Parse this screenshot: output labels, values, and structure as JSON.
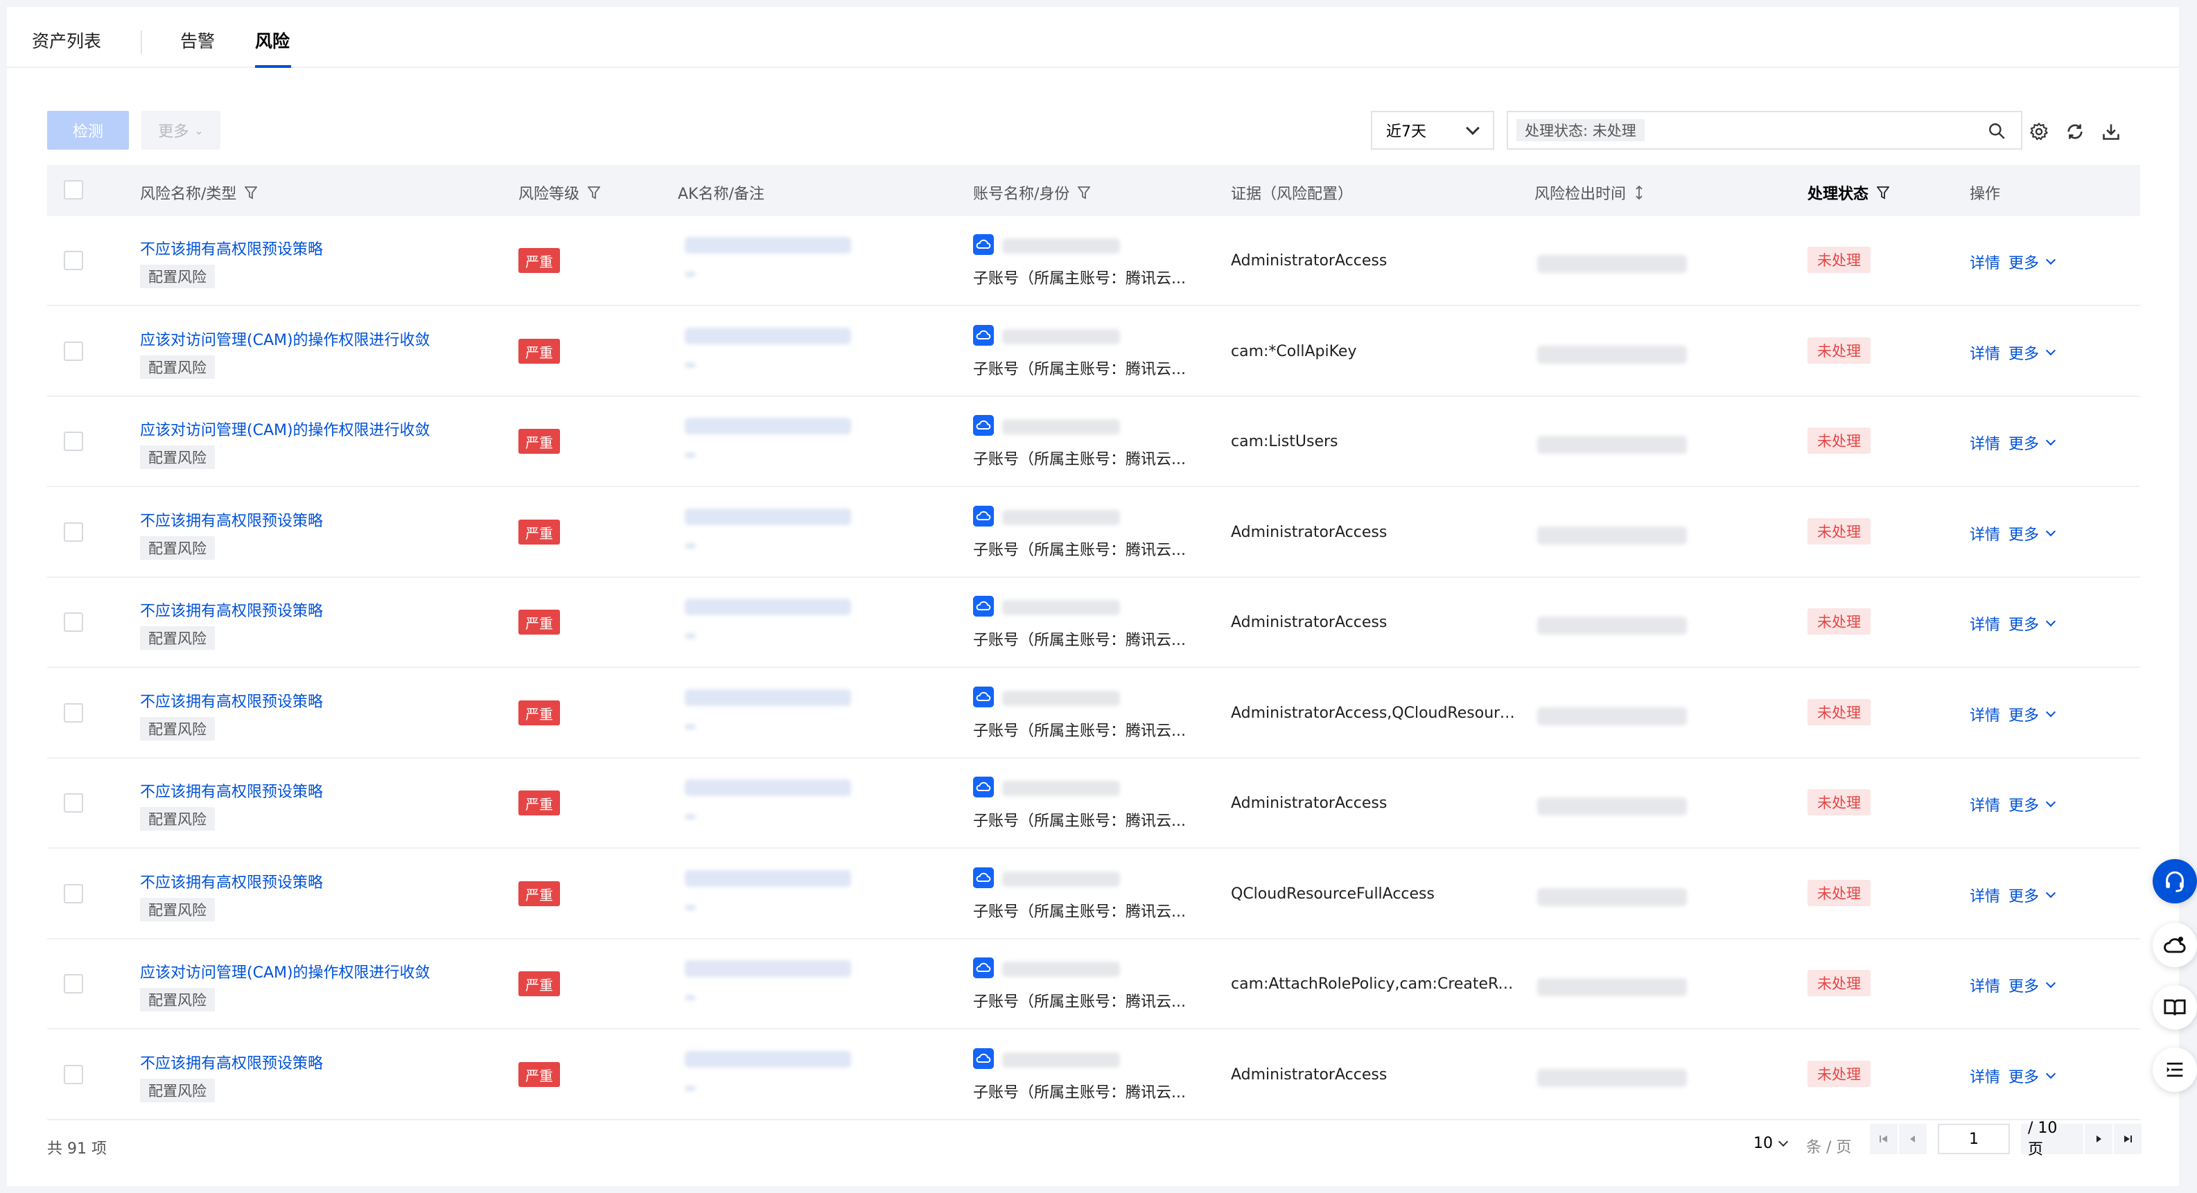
{
  "tabs": [
    {
      "label": "资产列表"
    },
    {
      "label": "告警"
    },
    {
      "label": "风险",
      "active": true
    }
  ],
  "toolbar": {
    "detect_label": "检测",
    "more_label": "更多",
    "time_range": "近7天",
    "filter_tag": "处理状态: 未处理"
  },
  "table": {
    "headers": {
      "risk_name": "风险名称/类型",
      "risk_level": "风险等级",
      "ak_name": "AK名称/备注",
      "account": "账号名称/身份",
      "evidence": "证据（风险配置）",
      "detect_time": "风险检出时间",
      "status": "处理状态",
      "ops": "操作"
    },
    "rows": [
      {
        "name": "不应该拥有高权限预设策略",
        "type": "配置风险",
        "level": "严重",
        "account": "子账号（所属主账号：腾讯云...",
        "evidence": "AdministratorAccess",
        "status": "未处理",
        "detail": "详情",
        "more": "更多"
      },
      {
        "name": "应该对访问管理(CAM)的操作权限进行收敛",
        "type": "配置风险",
        "level": "严重",
        "account": "子账号（所属主账号：腾讯云...",
        "evidence": "cam:*CollApiKey",
        "status": "未处理",
        "detail": "详情",
        "more": "更多"
      },
      {
        "name": "应该对访问管理(CAM)的操作权限进行收敛",
        "type": "配置风险",
        "level": "严重",
        "account": "子账号（所属主账号：腾讯云...",
        "evidence": "cam:ListUsers",
        "status": "未处理",
        "detail": "详情",
        "more": "更多"
      },
      {
        "name": "不应该拥有高权限预设策略",
        "type": "配置风险",
        "level": "严重",
        "account": "子账号（所属主账号：腾讯云...",
        "evidence": "AdministratorAccess",
        "status": "未处理",
        "detail": "详情",
        "more": "更多"
      },
      {
        "name": "不应该拥有高权限预设策略",
        "type": "配置风险",
        "level": "严重",
        "account": "子账号（所属主账号：腾讯云...",
        "evidence": "AdministratorAccess",
        "status": "未处理",
        "detail": "详情",
        "more": "更多"
      },
      {
        "name": "不应该拥有高权限预设策略",
        "type": "配置风险",
        "level": "严重",
        "account": "子账号（所属主账号：腾讯云...",
        "evidence": "AdministratorAccess,QCloudResourceF...",
        "status": "未处理",
        "detail": "详情",
        "more": "更多"
      },
      {
        "name": "不应该拥有高权限预设策略",
        "type": "配置风险",
        "level": "严重",
        "account": "子账号（所属主账号：腾讯云...",
        "evidence": "AdministratorAccess",
        "status": "未处理",
        "detail": "详情",
        "more": "更多"
      },
      {
        "name": "不应该拥有高权限预设策略",
        "type": "配置风险",
        "level": "严重",
        "account": "子账号（所属主账号：腾讯云...",
        "evidence": "QCloudResourceFullAccess",
        "status": "未处理",
        "detail": "详情",
        "more": "更多"
      },
      {
        "name": "应该对访问管理(CAM)的操作权限进行收敛",
        "type": "配置风险",
        "level": "严重",
        "account": "子账号（所属主账号：腾讯云...",
        "evidence": "cam:AttachRolePolicy,cam:CreateRole,c...",
        "status": "未处理",
        "detail": "详情",
        "more": "更多"
      },
      {
        "name": "不应该拥有高权限预设策略",
        "type": "配置风险",
        "level": "严重",
        "account": "子账号（所属主账号：腾讯云...",
        "evidence": "AdministratorAccess",
        "status": "未处理",
        "detail": "详情",
        "more": "更多"
      }
    ]
  },
  "footer": {
    "total": "共 91 项",
    "page_size": "10",
    "page_size_unit": "条 / 页",
    "current_page": "1",
    "total_pages": "/ 10 页"
  },
  "colors": {
    "primary": "#0052d9",
    "danger": "#e54545",
    "danger_bg": "#fbe5e5"
  },
  "icons": [
    "filter-icon",
    "sort-icon",
    "search-icon",
    "gear-icon",
    "refresh-icon",
    "download-icon",
    "cloud-account-icon",
    "first-page-icon",
    "prev-page-icon",
    "next-page-icon",
    "last-page-icon",
    "headset-icon",
    "cloud-chat-icon",
    "book-icon",
    "list-icon"
  ]
}
